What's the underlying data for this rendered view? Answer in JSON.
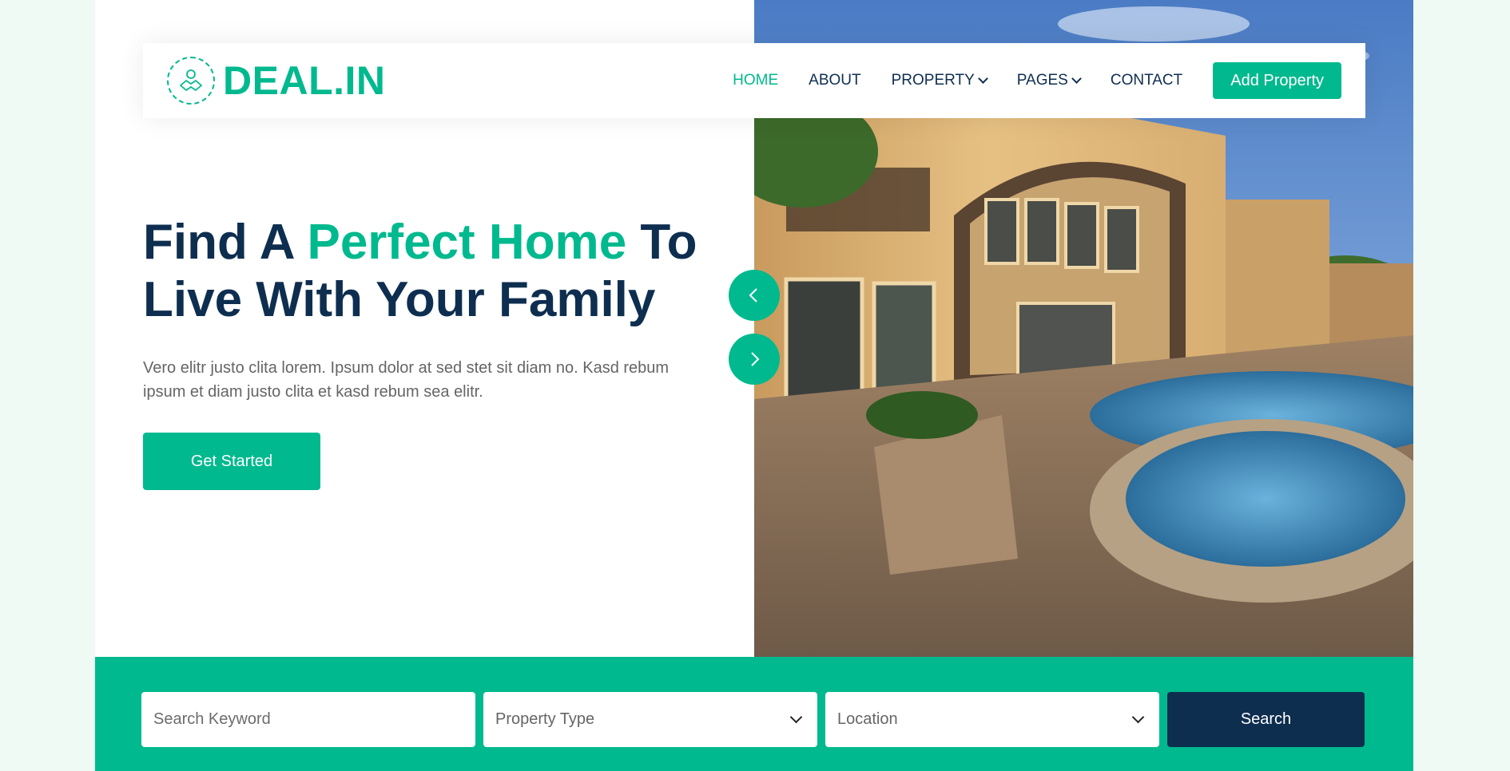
{
  "brand": {
    "name": "DEAL.IN",
    "icon": "handshake-icon"
  },
  "nav": {
    "items": [
      {
        "label": "HOME",
        "active": true,
        "dropdown": false
      },
      {
        "label": "ABOUT",
        "active": false,
        "dropdown": false
      },
      {
        "label": "PROPERTY",
        "active": false,
        "dropdown": true
      },
      {
        "label": "PAGES",
        "active": false,
        "dropdown": true
      },
      {
        "label": "CONTACT",
        "active": false,
        "dropdown": false
      }
    ],
    "cta_label": "Add Property"
  },
  "hero": {
    "title_part1": "Find A ",
    "title_accent": "Perfect Home",
    "title_part2": " To Live With Your Family",
    "description": "Vero elitr justo clita lorem. Ipsum dolor at sed stet sit diam no. Kasd rebum ipsum et diam justo clita et kasd rebum sea elitr.",
    "button_label": "Get Started",
    "image": "house-with-pool-photo"
  },
  "carousel": {
    "prev_icon": "chevron-left-icon",
    "next_icon": "chevron-right-icon"
  },
  "search": {
    "keyword_placeholder": "Search Keyword",
    "property_type": "Property Type",
    "location": "Location",
    "button_label": "Search"
  },
  "colors": {
    "accent": "#00b98e",
    "dark": "#0e2e50",
    "text": "#666565",
    "page_bg": "#eefaf3"
  }
}
